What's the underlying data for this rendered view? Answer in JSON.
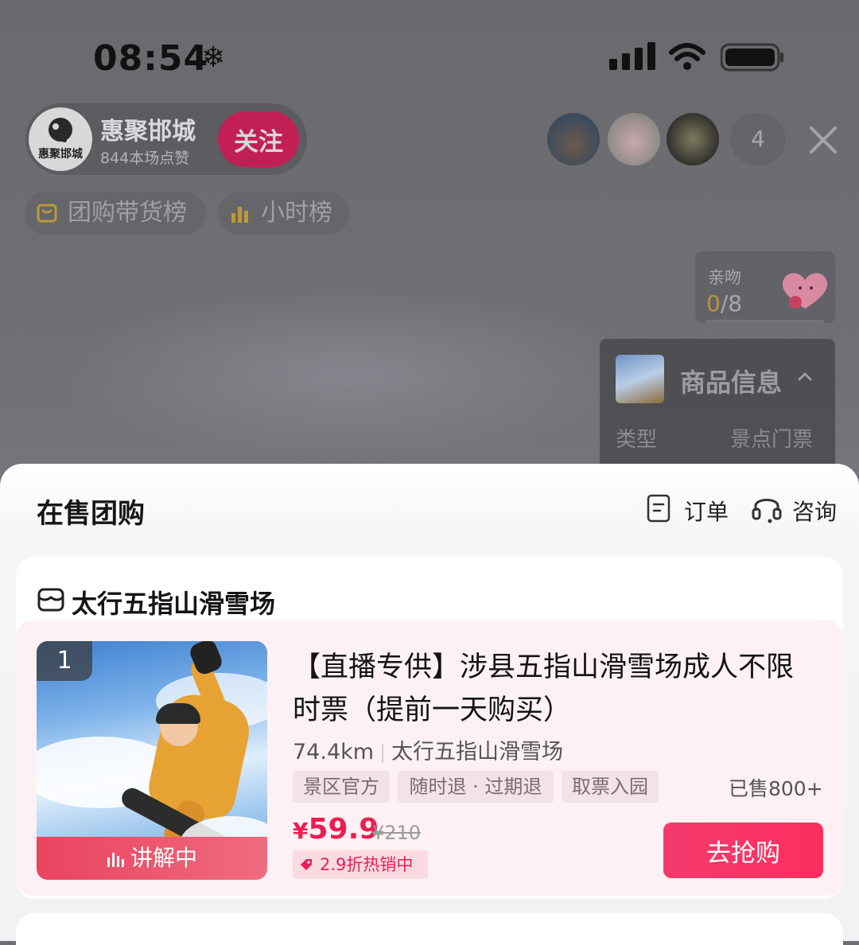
{
  "status_bar": {
    "time": "08:54",
    "weather_icon": "snowflake"
  },
  "host": {
    "name": "惠聚邯城",
    "avatar_text": "惠聚邯城",
    "likes": "844本场点赞",
    "follow_label": "关注",
    "follow_color": "#c21f55"
  },
  "viewers": {
    "count": "4"
  },
  "rank_chips": [
    {
      "label": "团购带货榜",
      "icon": "shopping-bag-icon"
    },
    {
      "label": "小时榜",
      "icon": "bar-chart-icon"
    }
  ],
  "kiss": {
    "label": "亲吻",
    "current": "0",
    "total": "/8",
    "progress": 0
  },
  "product_info": {
    "title": "商品信息",
    "key": "类型",
    "value": "景点门票"
  },
  "sheet": {
    "title": "在售团购",
    "order_label": "订单",
    "consult_label": "咨询"
  },
  "store": {
    "name": "太行五指山滑雪场"
  },
  "item": {
    "rank": "1",
    "live_label": "讲解中",
    "title": "【直播专供】涉县五指山滑雪场成人不限时票（提前一天购买）",
    "distance": "74.4km",
    "venue": "太行五指山滑雪场",
    "tags": [
      "景区官方",
      "随时退 · 过期退",
      "取票入园"
    ],
    "sold": "已售800+",
    "currency": "¥",
    "price": "59.9",
    "original_price": "¥210",
    "discount": "2.9折热销中",
    "buy_label": "去抢购",
    "accent_color": "#ea1e52"
  }
}
